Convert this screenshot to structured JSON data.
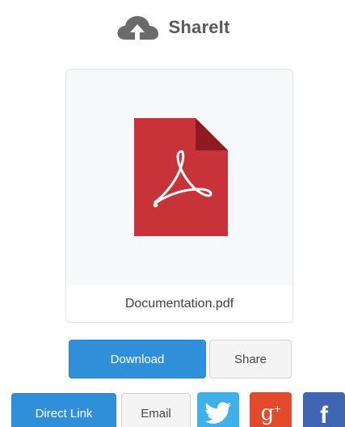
{
  "app": {
    "title": "ShareIt",
    "brand_icon": "cloud-upload-icon"
  },
  "file": {
    "name": "Documentation.pdf",
    "icon": "pdf-file-icon",
    "icon_color": "#c8333a"
  },
  "actions": {
    "download_label": "Download",
    "share_label": "Share",
    "direct_link_label": "Direct Link",
    "email_label": "Email"
  },
  "social": [
    {
      "name": "twitter",
      "icon": "twitter-bird-icon",
      "color": "#3fb0e9"
    },
    {
      "name": "google-plus",
      "icon": "google-plus-icon",
      "label": "g+",
      "color": "#e14a2a"
    },
    {
      "name": "facebook",
      "icon": "facebook-icon",
      "label": "f",
      "color": "#3f65b5"
    }
  ],
  "colors": {
    "primary": "#2f8fd9",
    "secondary_bg": "#f4f4f4",
    "title_text": "#5a5a5a"
  }
}
